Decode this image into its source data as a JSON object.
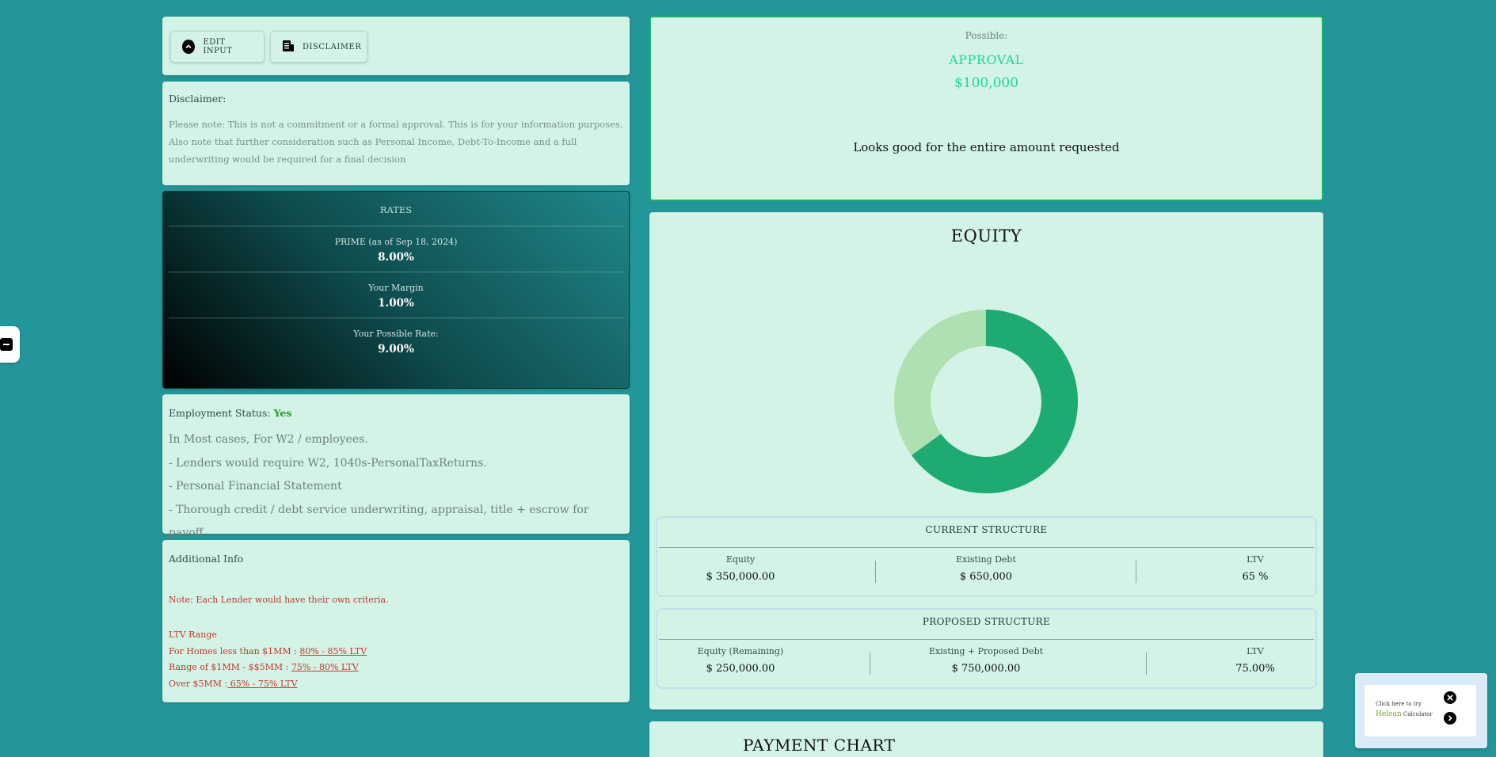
{
  "actions": {
    "edit_input": "EDIT INPUT",
    "disclaimer": "DISCLAIMER"
  },
  "disclaimer": {
    "title": "Disclaimer:",
    "text": "Please note: This is not a commitment or a formal approval. This is for your information purposes. Also note that further consideration such as Personal Income, Debt-To-Income and a full underwriting would be required for a final decision"
  },
  "rates": {
    "header": "RATES",
    "items": [
      {
        "label": "PRIME (as of Sep 18, 2024)",
        "value": "8.00%"
      },
      {
        "label": "Your Margin",
        "value": "1.00%"
      },
      {
        "label": "Your Possible Rate:",
        "value": "9.00%"
      }
    ]
  },
  "employment": {
    "label": "Employment Status:",
    "status": "Yes",
    "lines": [
      "In Most cases, For W2 / employees.",
      "- Lenders would require W2, 1040s-PersonalTaxReturns.",
      "- Personal Financial Statement",
      "- Thorough credit / debt service underwriting, appraisal, title + escrow for payoff."
    ]
  },
  "additional": {
    "title": "Additional Info",
    "note": "Note: Each Lender would have their own criteria.",
    "ltv_title": "LTV Range",
    "ranges": [
      {
        "label": "For Homes less than $1MM : ",
        "value": "80% - 85% LTV"
      },
      {
        "label": "Range of $1MM - $$5MM : ",
        "value": "75% - 80% LTV"
      },
      {
        "label": "Over $5MM :",
        "value": " 65% - 75% LTV"
      }
    ]
  },
  "possible": {
    "label": "Possible:",
    "status": "APPROVAL",
    "amount": "$100,000",
    "message": "Looks good for the entire amount requested"
  },
  "equity": {
    "title": "EQUITY",
    "donut": {
      "colors": {
        "debt": "#1eab72",
        "equity": "#aee0b2"
      },
      "debt_fraction": 0.65,
      "equity_fraction": 0.35
    },
    "current": {
      "title": "CURRENT STRUCTURE",
      "equity_label": "Equity",
      "equity_value": "$ 350,000.00",
      "debt_label": "Existing Debt",
      "debt_value": "$ 650,000",
      "ltv_label": "LTV",
      "ltv_value": "65 %"
    },
    "proposed": {
      "title": "PROPOSED STRUCTURE",
      "equity_label": "Equity (Remaining)",
      "equity_value": "$ 250,000.00",
      "debt_label": "Existing + Proposed Debt",
      "debt_value": "$ 750,000.00",
      "ltv_label": "LTV",
      "ltv_value": "75.00%"
    }
  },
  "payment_chart": {
    "title": "PAYMENT CHART"
  },
  "heloan": {
    "prefix": "Click here to try",
    "highlight": "Heloan",
    "suffix": "Calculator"
  },
  "colors": {
    "accent": "#1cd99a",
    "background": "#23969a",
    "card": "#d3f3e7"
  }
}
